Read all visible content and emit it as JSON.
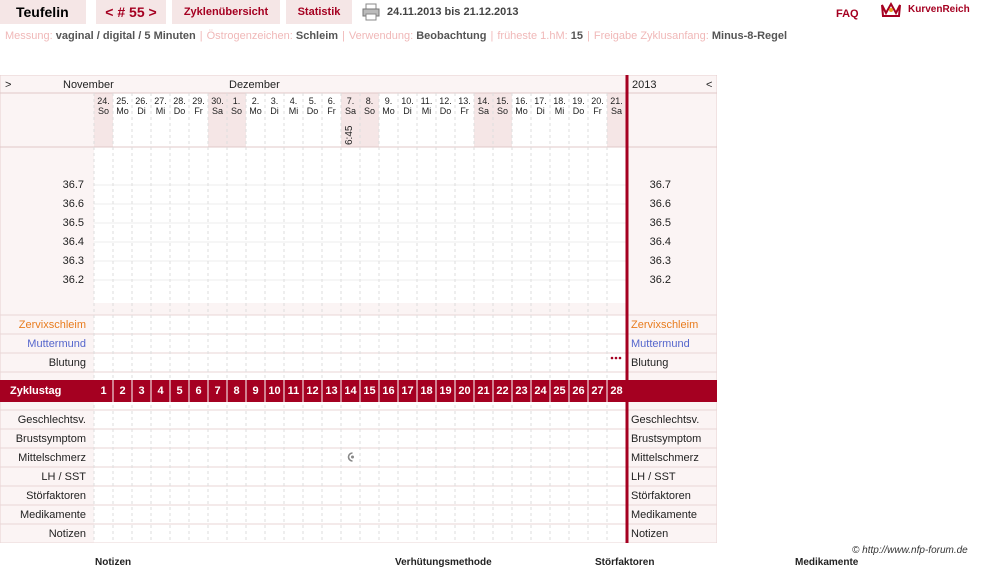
{
  "header": {
    "name": "Teufelin",
    "cycle_label": "< # 55 >",
    "tab_overview": "Zyklenübersicht",
    "tab_stats": "Statistik",
    "date_range": "24.11.2013 bis 21.12.2013",
    "faq": "FAQ",
    "logo": "KurvenReich",
    "printer_icon": "printer-icon",
    "logo_icon": "crown-icon"
  },
  "settings": {
    "measure_label": "Messung:",
    "measure_value": "vaginal / digital / 5 Minuten",
    "estrogen_label": "Östrogenzeichen:",
    "estrogen_value": "Schleim",
    "usage_label": "Verwendung:",
    "usage_value": "Beobachtung",
    "earliest_label": "früheste 1.hM:",
    "earliest_value": "15",
    "release_label": "Freigabe Zyklusanfang:",
    "release_value": "Minus-8-Regel"
  },
  "chart": {
    "nav_left": ">",
    "nav_right": "<",
    "month_nov": "November",
    "month_dec": "Dezember",
    "year": "2013",
    "days": [
      {
        "d": "24.",
        "w": "So",
        "we": true
      },
      {
        "d": "25.",
        "w": "Mo",
        "we": false
      },
      {
        "d": "26.",
        "w": "Di",
        "we": false
      },
      {
        "d": "27.",
        "w": "Mi",
        "we": false
      },
      {
        "d": "28.",
        "w": "Do",
        "we": false
      },
      {
        "d": "29.",
        "w": "Fr",
        "we": false
      },
      {
        "d": "30.",
        "w": "Sa",
        "we": true
      },
      {
        "d": "1.",
        "w": "So",
        "we": true
      },
      {
        "d": "2.",
        "w": "Mo",
        "we": false
      },
      {
        "d": "3.",
        "w": "Di",
        "we": false
      },
      {
        "d": "4.",
        "w": "Mi",
        "we": false
      },
      {
        "d": "5.",
        "w": "Do",
        "we": false
      },
      {
        "d": "6.",
        "w": "Fr",
        "we": false
      },
      {
        "d": "7.",
        "w": "Sa",
        "we": true
      },
      {
        "d": "8.",
        "w": "So",
        "we": true
      },
      {
        "d": "9.",
        "w": "Mo",
        "we": false
      },
      {
        "d": "10.",
        "w": "Di",
        "we": false
      },
      {
        "d": "11.",
        "w": "Mi",
        "we": false
      },
      {
        "d": "12.",
        "w": "Do",
        "we": false
      },
      {
        "d": "13.",
        "w": "Fr",
        "we": false
      },
      {
        "d": "14.",
        "w": "Sa",
        "we": true
      },
      {
        "d": "15.",
        "w": "So",
        "we": true
      },
      {
        "d": "16.",
        "w": "Mo",
        "we": false
      },
      {
        "d": "17.",
        "w": "Di",
        "we": false
      },
      {
        "d": "18.",
        "w": "Mi",
        "we": false
      },
      {
        "d": "19.",
        "w": "Do",
        "we": false
      },
      {
        "d": "20.",
        "w": "Fr",
        "we": false
      },
      {
        "d": "21.",
        "w": "Sa",
        "we": true
      }
    ],
    "time_note": "6:45",
    "temps": [
      "36.7",
      "36.6",
      "36.5",
      "36.4",
      "36.3",
      "36.2"
    ],
    "labels": {
      "zervix": "Zervixschleim",
      "muttermund": "Muttermund",
      "blutung": "Blutung",
      "zyklustag": "Zyklustag",
      "geschlecht": "Geschlechtsv.",
      "brust": "Brustsymptom",
      "mittel": "Mittelschmerz",
      "lh": "LH / SST",
      "stoer": "Störfaktoren",
      "medi": "Medikamente",
      "notizen": "Notizen"
    },
    "cycle_days": [
      "1",
      "2",
      "3",
      "4",
      "5",
      "6",
      "7",
      "8",
      "9",
      "10",
      "11",
      "12",
      "13",
      "14",
      "15",
      "16",
      "17",
      "18",
      "19",
      "20",
      "21",
      "22",
      "23",
      "24",
      "25",
      "26",
      "27",
      "28"
    ],
    "colors": {
      "accent": "#a50021",
      "weekend": "#f5e6e6",
      "zervix": "#e87c1e",
      "muttermund": "#5566cc"
    }
  },
  "footer": {
    "copyright": "© http://www.nfp-forum.de",
    "h1": "Notizen",
    "h2": "Verhütungsmethode",
    "h3": "Störfaktoren",
    "h4": "Medikamente"
  }
}
